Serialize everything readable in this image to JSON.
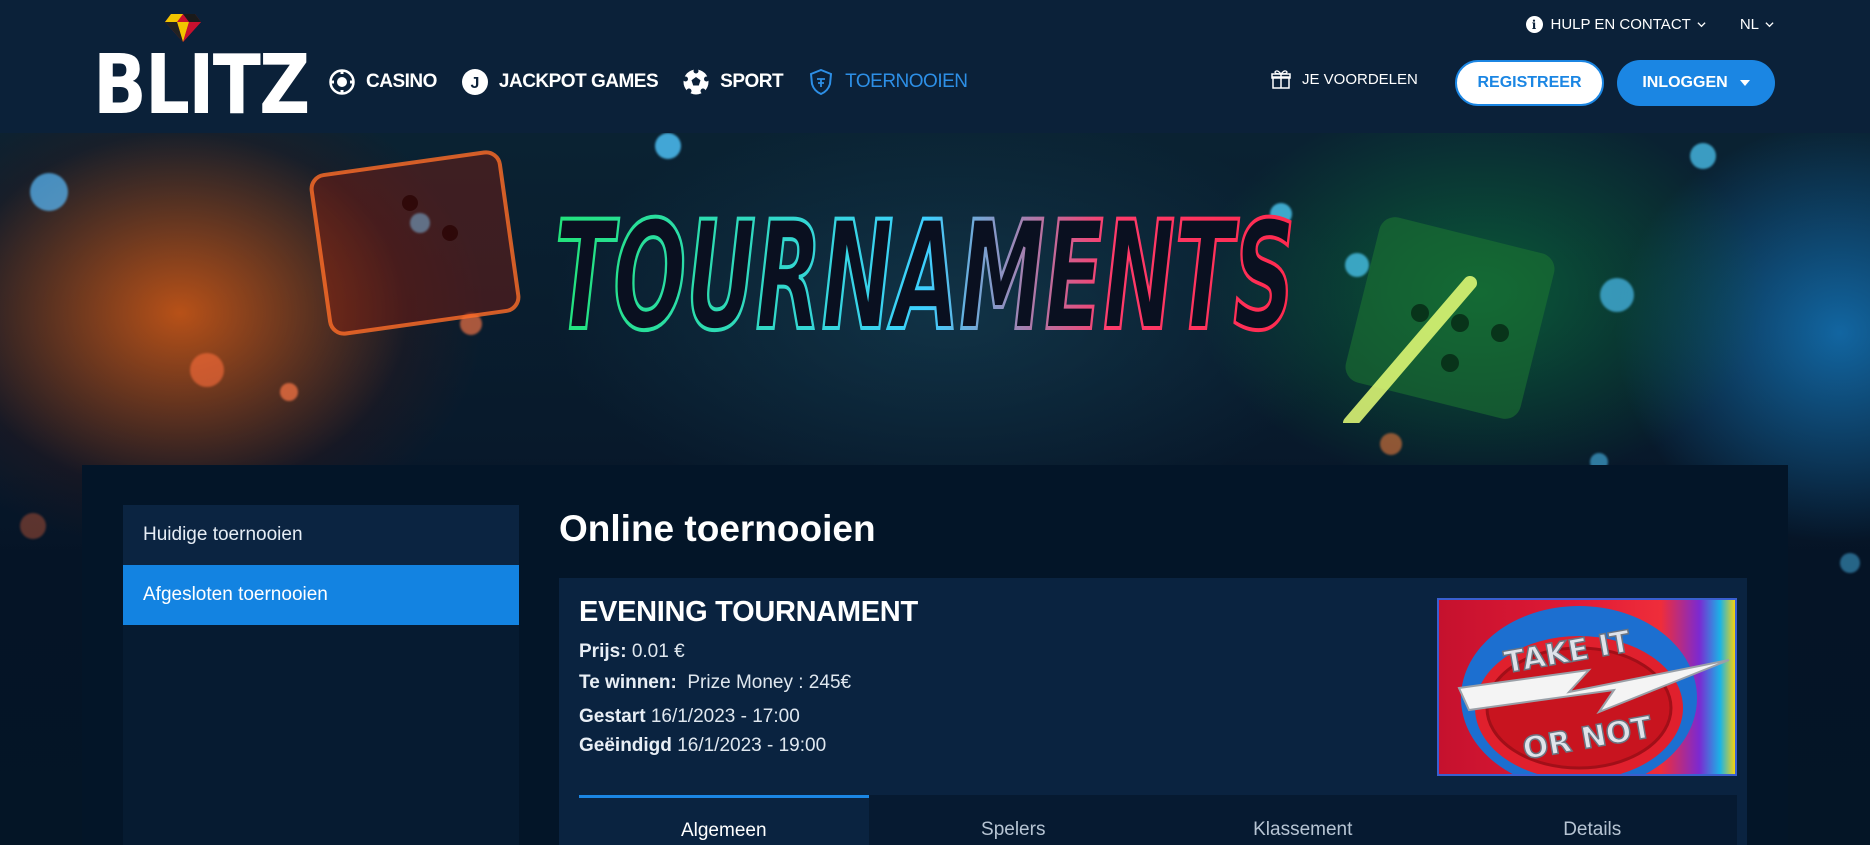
{
  "header": {
    "logo_text": "BLITZ",
    "nav": [
      {
        "label": "CASINO",
        "icon": "casino-chip-icon"
      },
      {
        "label": "JACKPOT GAMES",
        "icon": "jackpot-j-icon"
      },
      {
        "label": "SPORT",
        "icon": "soccer-ball-icon"
      },
      {
        "label": "TOERNOOIEN",
        "icon": "tournament-shield-icon",
        "active": true
      }
    ],
    "help_label": "HULP EN CONTACT",
    "language": "NL",
    "perks_label": "JE VOORDELEN",
    "register_label": "REGISTREER",
    "login_label": "INLOGGEN"
  },
  "hero": {
    "title": "TOURNAMENTS"
  },
  "sidebar": {
    "items": [
      {
        "label": "Huidige toernooien",
        "active": false
      },
      {
        "label": "Afgesloten toernooien",
        "active": true
      }
    ]
  },
  "main": {
    "page_title": "Online toernooien",
    "tournament": {
      "name": "EVENING TOURNAMENT",
      "price_label": "Prijs:",
      "price_value": "0.01 €",
      "win_label": "Te winnen:",
      "win_value": "Prize Money : 245€",
      "start_label": "Gestart",
      "start_value": "16/1/2023 - 17:00",
      "end_label": "Geëindigd",
      "end_value": "16/1/2023 - 19:00",
      "image_text_top": "TAKE IT",
      "image_text_bottom": "OR NOT"
    },
    "tabs": [
      {
        "label": "Algemeen",
        "active": true
      },
      {
        "label": "Spelers",
        "active": false
      },
      {
        "label": "Klassement",
        "active": false
      },
      {
        "label": "Details",
        "active": false
      }
    ]
  },
  "colors": {
    "header_bg": "#0b2139",
    "accent": "#1b86e3",
    "page_bg": "#041526"
  }
}
